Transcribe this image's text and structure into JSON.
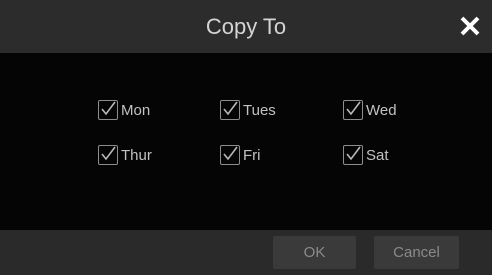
{
  "dialog": {
    "title": "Copy To",
    "close_icon": "close-icon",
    "days": [
      {
        "label": "Mon",
        "checked": true
      },
      {
        "label": "Tues",
        "checked": true
      },
      {
        "label": "Wed",
        "checked": true
      },
      {
        "label": "Thur",
        "checked": true
      },
      {
        "label": "Fri",
        "checked": true
      },
      {
        "label": "Sat",
        "checked": true
      }
    ],
    "ok_label": "OK",
    "cancel_label": "Cancel"
  },
  "colors": {
    "titlebar_bg": "#2c2c2c",
    "body_bg": "#050505",
    "footer_bg": "#2a2a2a",
    "text": "#c2c2c2",
    "button_bg": "#3a3a3a"
  }
}
